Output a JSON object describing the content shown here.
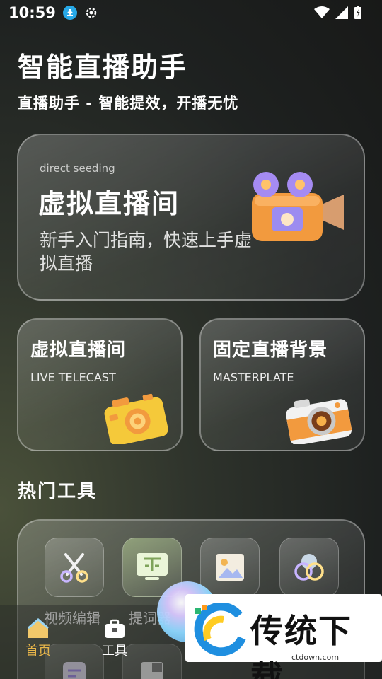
{
  "status_bar": {
    "time": "10:59",
    "icons": [
      "download-icon",
      "gear-icon",
      "wifi-icon",
      "signal-icon",
      "battery-charging-icon"
    ]
  },
  "header": {
    "title": "智能直播助手",
    "subtitle": "直播助手 - 智能提效，开播无忧"
  },
  "hero_card": {
    "en": "direct seeding",
    "title": "虚拟直播间",
    "desc": "新手入门指南，快速上手虚拟直播",
    "icon": "video-camera-icon"
  },
  "cards": [
    {
      "title": "虚拟直播间",
      "en": "LIVE TELECAST",
      "icon": "yellow-camera-icon"
    },
    {
      "title": "固定直播背景",
      "en": "MASTERPLATE",
      "icon": "orange-camera-icon"
    }
  ],
  "tools_section": {
    "title": "热门工具",
    "tools": [
      {
        "label": "视频编辑",
        "icon": "scissors-icon"
      },
      {
        "label": "提词器",
        "icon": "teleprompter-icon"
      },
      {
        "label": "",
        "icon": "image-icon"
      },
      {
        "label": "",
        "icon": "color-circles-icon"
      }
    ]
  },
  "bottom_nav": {
    "items": [
      {
        "label": "首页",
        "icon": "home-icon",
        "active": true,
        "color": "#e8b64a"
      },
      {
        "label": "工具",
        "icon": "toolbox-icon",
        "active": false
      }
    ]
  },
  "watermark": {
    "text": "传统下载",
    "sub": "ctdown.com"
  }
}
